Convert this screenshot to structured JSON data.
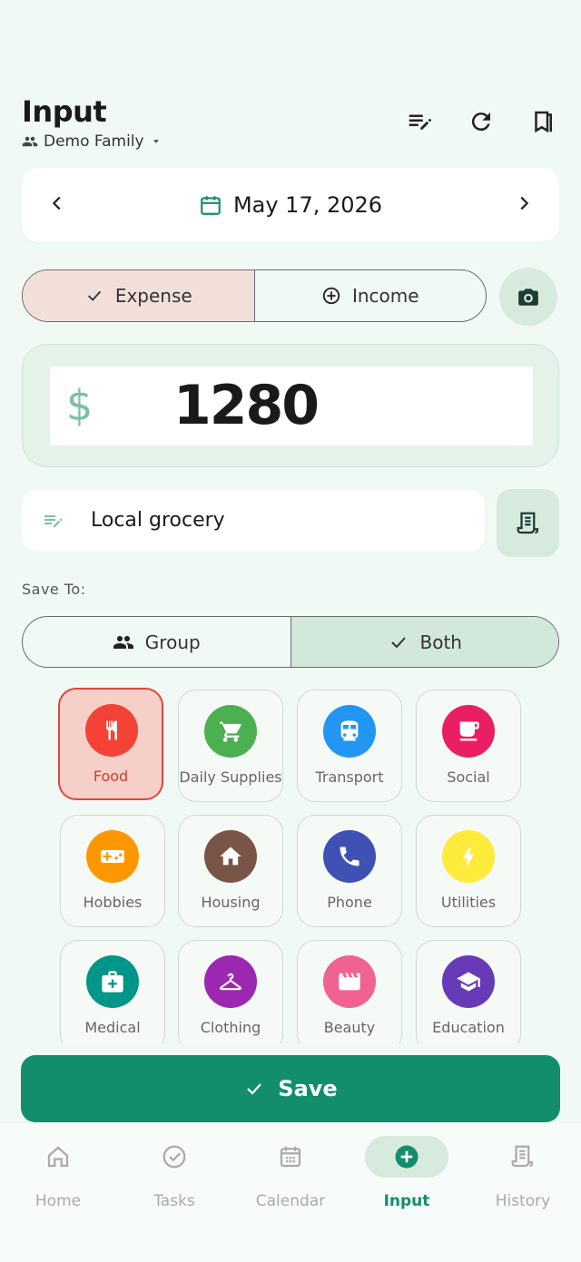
{
  "header": {
    "title": "Input",
    "group_name": "Demo Family",
    "icons": [
      "edit-list-icon",
      "refresh-icon",
      "bookmarks-icon"
    ]
  },
  "date_nav": {
    "date": "May 17, 2026"
  },
  "type_toggle": {
    "expense_label": "Expense",
    "income_label": "Income",
    "selected": "Expense"
  },
  "amount": {
    "currency": "$",
    "value": "1280"
  },
  "memo": {
    "value": "Local grocery"
  },
  "save_to": {
    "label": "Save To:",
    "group_label": "Group",
    "both_label": "Both",
    "selected": "Both"
  },
  "categories": [
    {
      "label": "Food",
      "color": "#f44336",
      "icon": "utensils-icon",
      "selected": true
    },
    {
      "label": "Daily Supplies",
      "color": "#4caf50",
      "icon": "cart-icon"
    },
    {
      "label": "Transport",
      "color": "#2196f3",
      "icon": "train-icon"
    },
    {
      "label": "Social",
      "color": "#e91e63",
      "icon": "cup-icon"
    },
    {
      "label": "Hobbies",
      "color": "#ff9800",
      "icon": "gamepad-icon"
    },
    {
      "label": "Housing",
      "color": "#795548",
      "icon": "home-icon"
    },
    {
      "label": "Phone",
      "color": "#3f51b5",
      "icon": "phone-icon"
    },
    {
      "label": "Utilities",
      "color": "#ffeb3b",
      "icon": "bolt-icon"
    },
    {
      "label": "Medical",
      "color": "#009688",
      "icon": "medical-kit-icon"
    },
    {
      "label": "Clothing",
      "color": "#9c27b0",
      "icon": "hanger-icon"
    },
    {
      "label": "Beauty",
      "color": "#f06292",
      "icon": "clapper-icon"
    },
    {
      "label": "Education",
      "color": "#673ab7",
      "icon": "graduation-cap-icon"
    }
  ],
  "save_button": {
    "label": "Save"
  },
  "bottom_nav": [
    {
      "label": "Home",
      "icon": "home-icon"
    },
    {
      "label": "Tasks",
      "icon": "check-circle-icon"
    },
    {
      "label": "Calendar",
      "icon": "calendar-icon"
    },
    {
      "label": "Input",
      "icon": "add-circle-icon",
      "active": true
    },
    {
      "label": "History",
      "icon": "receipt-icon"
    }
  ],
  "colors": {
    "accent": "#128e6c",
    "selected_red": "#e0453c",
    "background": "#f1f9f5"
  }
}
